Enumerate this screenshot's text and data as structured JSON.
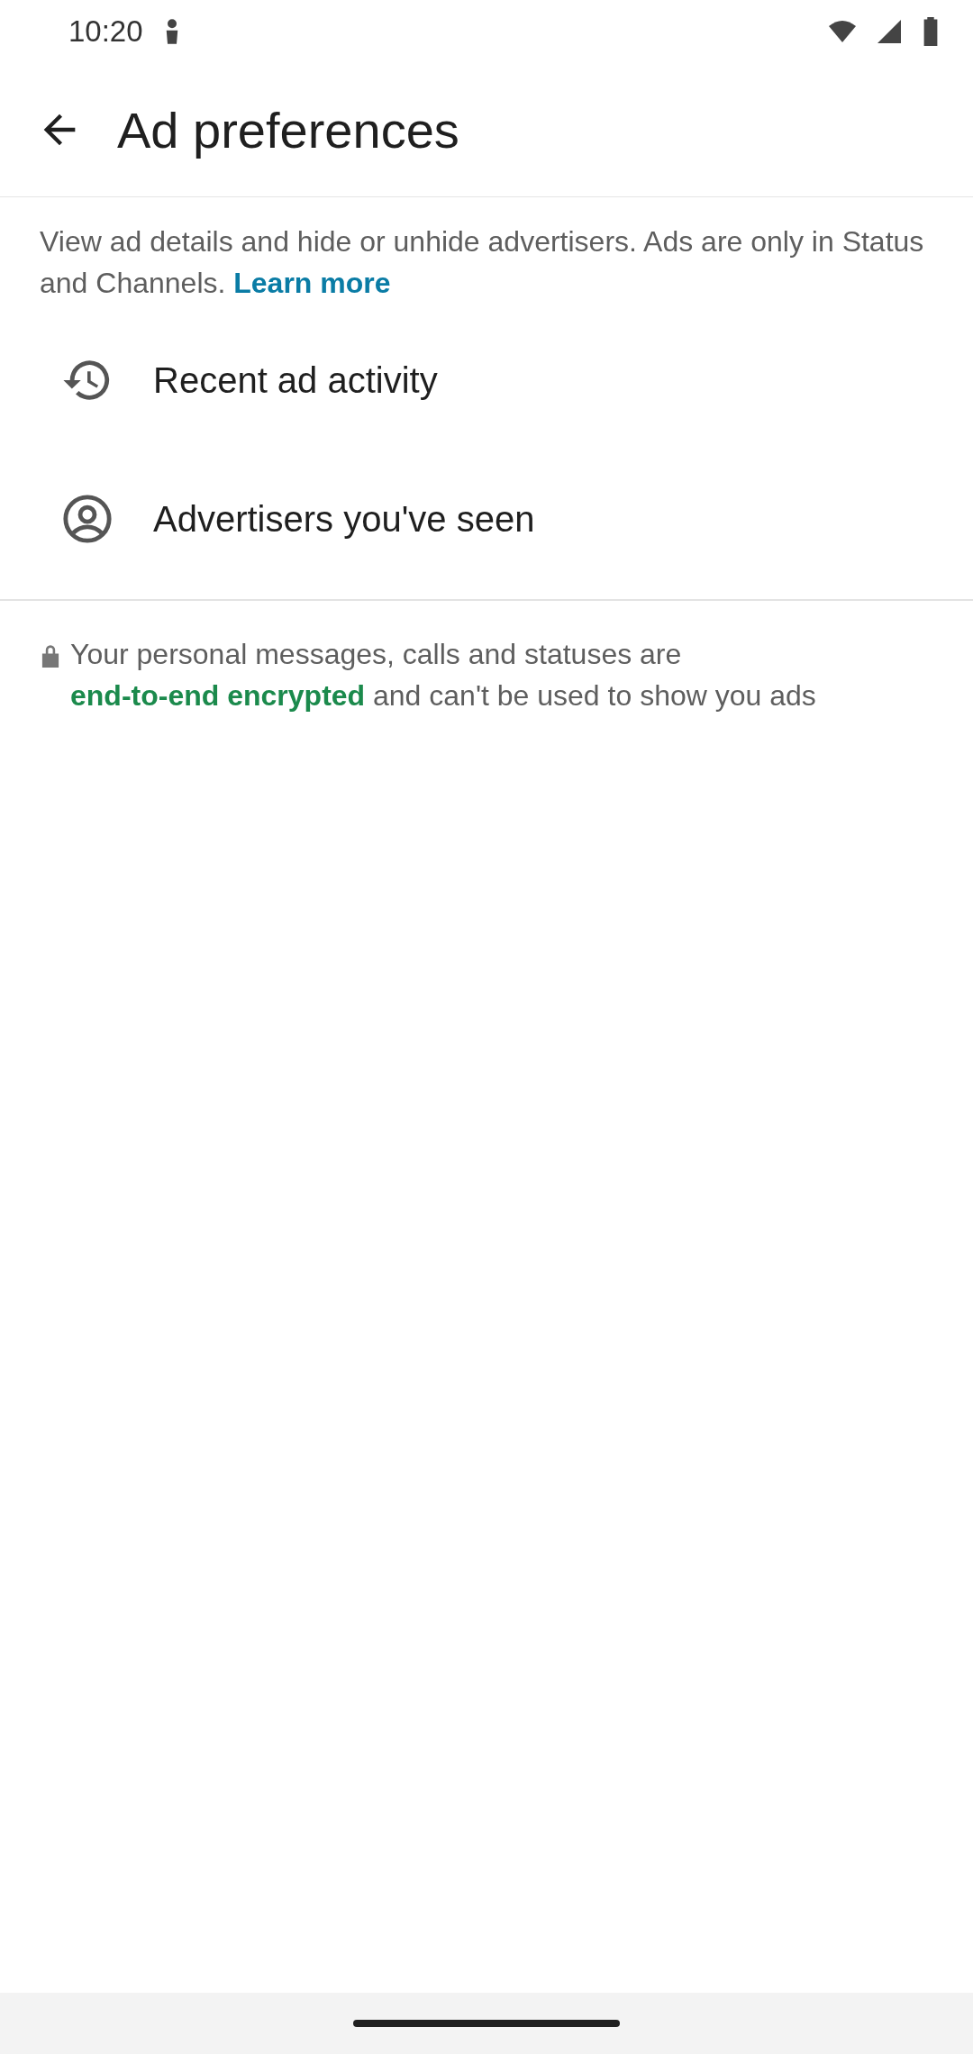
{
  "status_bar": {
    "time": "10:20"
  },
  "app_bar": {
    "title": "Ad preferences"
  },
  "description": {
    "text": "View ad details and hide or unhide advertisers. Ads are only in Status and Channels.",
    "link": "Learn more"
  },
  "items": [
    {
      "kind": "history",
      "label": "Recent ad activity"
    },
    {
      "kind": "account",
      "label": "Advertisers you've seen"
    }
  ],
  "footer": {
    "text_before": "Your personal messages, calls and statuses are",
    "link": "end-to-end encrypted",
    "text_after": "and can't be used to show you ads"
  }
}
